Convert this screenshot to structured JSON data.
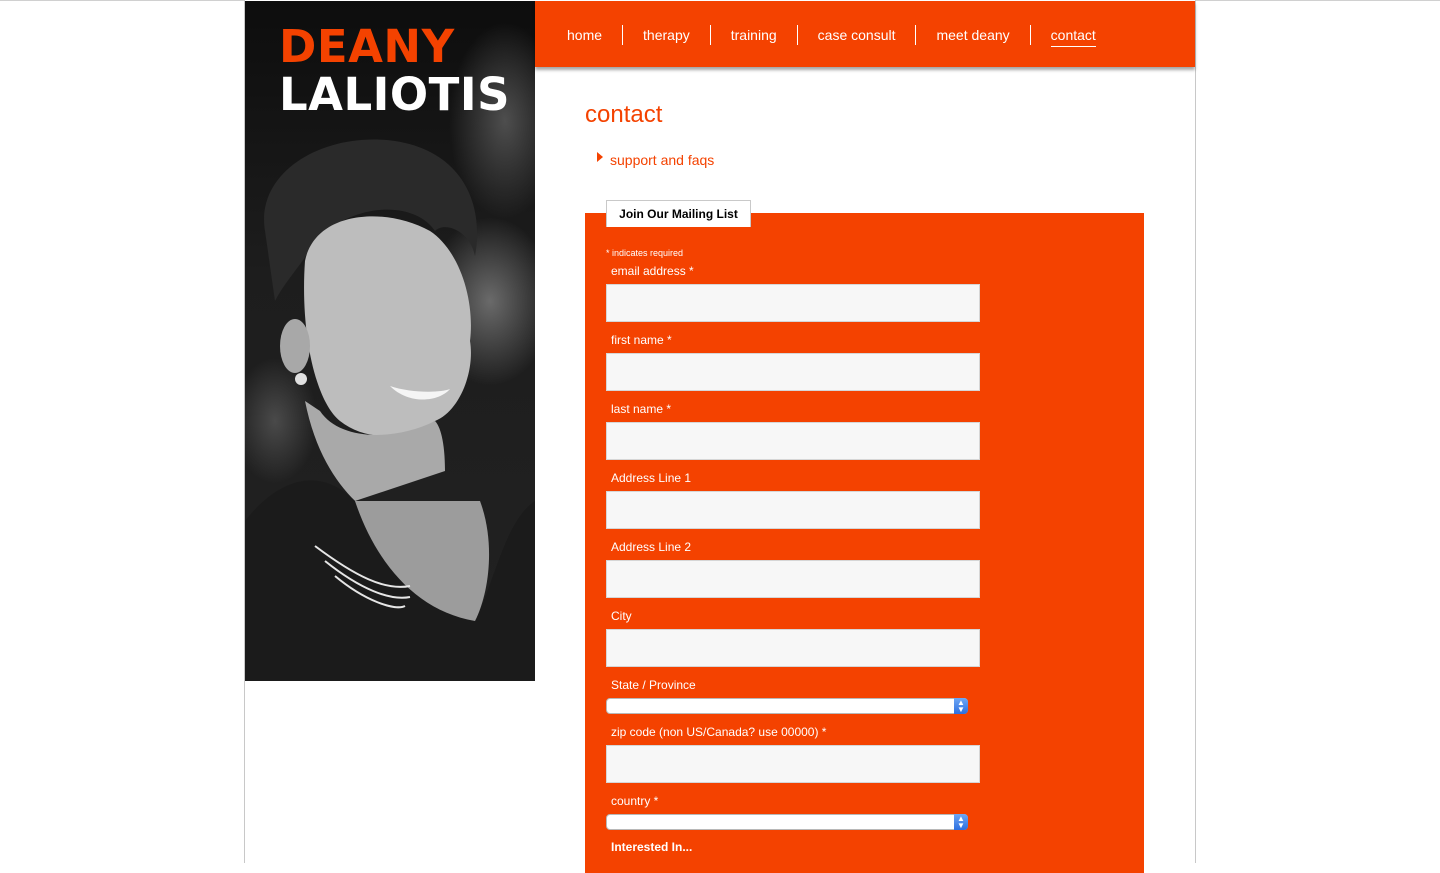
{
  "brand": {
    "first": "DEANY",
    "last": "LALIOTIS"
  },
  "nav": {
    "items": [
      "home",
      "therapy",
      "training",
      "case consult",
      "meet deany",
      "contact"
    ],
    "active": "contact"
  },
  "page": {
    "title": "contact",
    "sub_link": "support and faqs"
  },
  "form": {
    "tab_label": "Join Our Mailing List",
    "required_note": "* indicates required",
    "fields": {
      "email": "email address *",
      "first_name": "first name *",
      "last_name": "last name *",
      "address1": "Address Line 1",
      "address2": "Address Line 2",
      "city": "City",
      "state": "State / Province",
      "zip": "zip code (non US/Canada? use 00000) *",
      "country": "country *"
    },
    "interested_label": "Interested In..."
  },
  "colors": {
    "accent": "#f44200"
  }
}
